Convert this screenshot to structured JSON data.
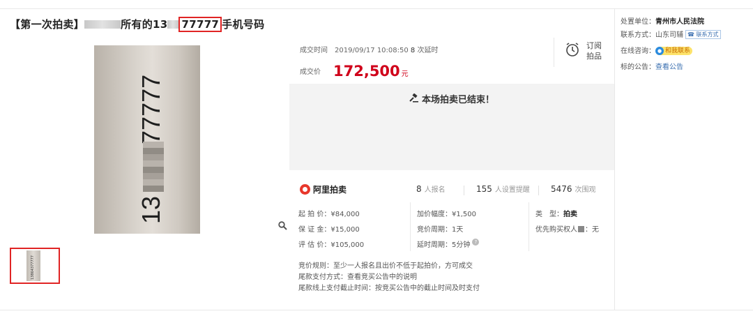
{
  "title": {
    "prefix": "【第一次拍卖】",
    "mid": "所有的13",
    "highlight": "77777",
    "suffix": "手机号码"
  },
  "image": {
    "main_digits": "13",
    "main_tail": "77777",
    "thumb_text": "13864377777"
  },
  "deal": {
    "time_label": "成交时间",
    "time_value": "2019/09/17 10:08:50",
    "extension_count": "8",
    "extension_label": "次延时",
    "price_label": "成交价",
    "price_value": "172,500",
    "price_unit": "元"
  },
  "subscribe": {
    "line1": "订阅",
    "line2": "拍品"
  },
  "status": {
    "message": "本场拍卖已结束！"
  },
  "stats": {
    "brand": "阿里拍卖",
    "signups": "8",
    "signups_label": "人报名",
    "reminders": "155",
    "reminders_label": "人设置提醒",
    "views": "5476",
    "views_label": "次围观"
  },
  "details": {
    "start_price": "起 拍 价：¥84,000",
    "increment": "加价幅度：¥1,500",
    "type_label": "类　型：",
    "type_value": "拍卖",
    "deposit": "保 证 金：¥15,000",
    "cycle": "竞价周期：1天",
    "priority": "优先购买权人",
    "priority_value": "：无",
    "appraisal": "评 估 价：¥105,000",
    "delay": "延时周期：5分钟"
  },
  "rules": {
    "line1": "竞价规则：至少一人报名且出价不低于起拍价，方可成交",
    "line2": "尾款支付方式：查看竞买公告中的说明",
    "line3": "尾款线上支付截止时间：按竞买公告中的截止时间及时支付"
  },
  "right_panel": {
    "unit_label": "处置单位：",
    "unit_value": "青州市人民法院",
    "contact_label": "联系方式：",
    "contact_value": "山东司辅",
    "contact_tag": "联系方式",
    "consult_label": "在线咨询：",
    "consult_button": "和我联系",
    "notice_label": "标的公告：",
    "notice_link": "查看公告"
  }
}
